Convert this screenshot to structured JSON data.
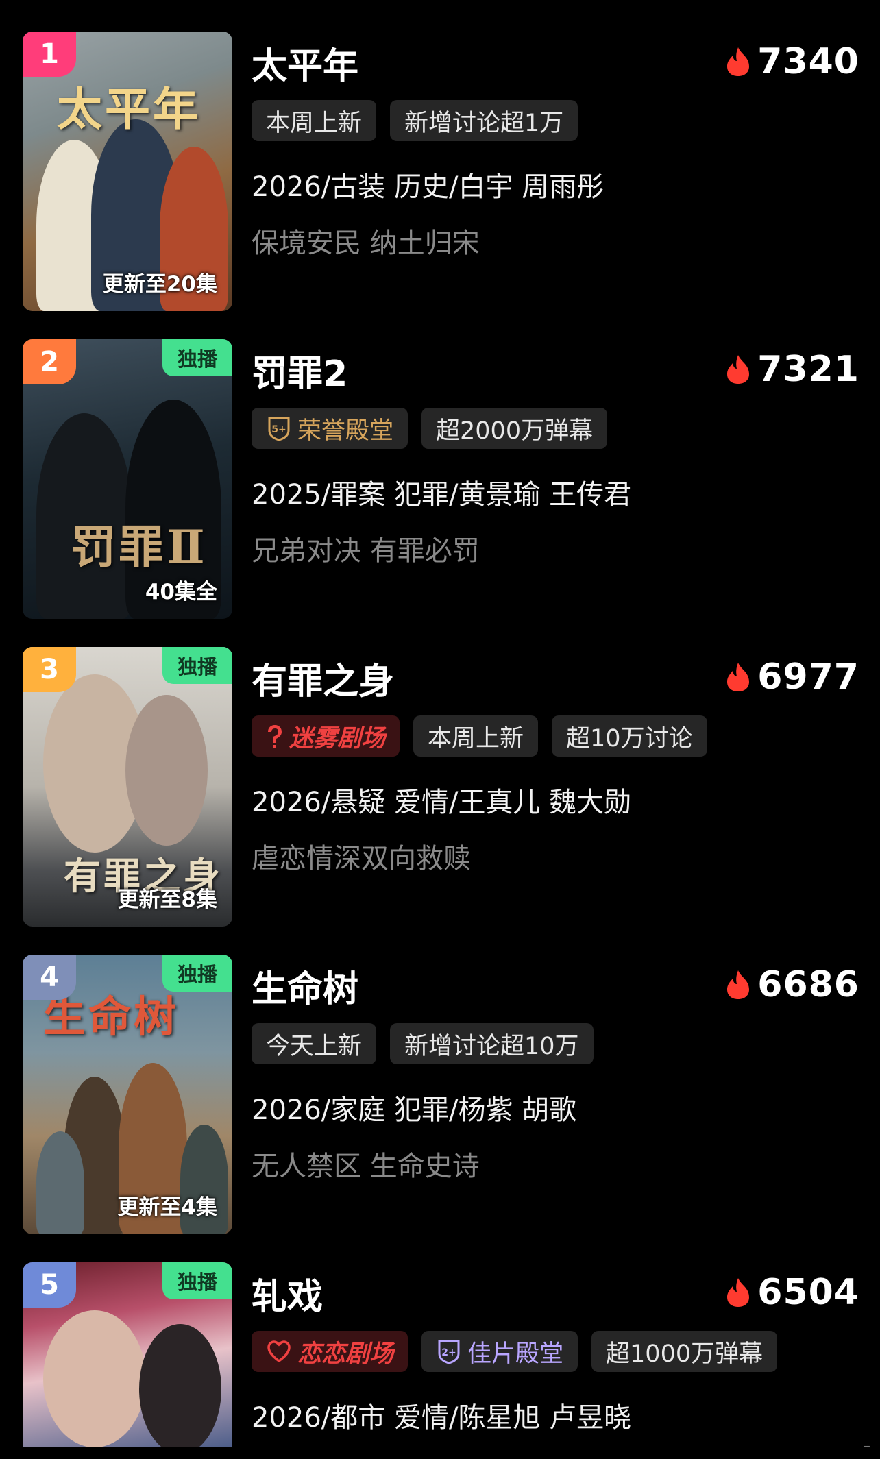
{
  "items": [
    {
      "rank": "1",
      "rank_color": "#ff3d7a",
      "exclusive": "",
      "poster_title": "太平年",
      "poster_bg": "linear-gradient(160deg,#9aa3a6 0%,#7e8a8c 30%,#8f6a43 60%,#5a3a24 100%)",
      "episodes": "更新至20集",
      "title": "太平年",
      "heat": "7340",
      "tags": [
        {
          "text": "本周上新",
          "style": "plain"
        },
        {
          "text": "新增讨论超1万",
          "style": "plain"
        }
      ],
      "meta": "2026/古装 历史/白宇 周雨彤",
      "desc": "保境安民 纳土归宋"
    },
    {
      "rank": "2",
      "rank_color": "#ff7a3d",
      "exclusive": "独播",
      "poster_title": "罚罪Ⅱ",
      "poster_bg": "linear-gradient(170deg,#3f4f5c 0%,#1d2a33 45%,#0d141a 100%)",
      "episodes": "40集全",
      "title": "罚罪2",
      "heat": "7321",
      "tags": [
        {
          "text": "荣誉殿堂",
          "style": "gold",
          "icon": "honor-hall-badge-icon",
          "badge": "5+"
        },
        {
          "text": "超2000万弹幕",
          "style": "plain"
        }
      ],
      "meta": "2025/罪案 犯罪/黄景瑜 王传君",
      "desc": "兄弟对决 有罪必罚"
    },
    {
      "rank": "3",
      "rank_color": "#ffb13d",
      "exclusive": "独播",
      "poster_title": "有罪之身",
      "poster_bg": "linear-gradient(180deg,#d9d6cf 0%,#b7b3ab 50%,#4d4f52 80%,#2a2c2e 100%)",
      "episodes": "更新至8集",
      "title": "有罪之身",
      "heat": "6977",
      "tags": [
        {
          "text": "迷雾剧场",
          "style": "red",
          "icon": "mist-theater-logo-icon"
        },
        {
          "text": "本周上新",
          "style": "plain"
        },
        {
          "text": "超10万讨论",
          "style": "plain"
        }
      ],
      "meta": "2026/悬疑 爱情/王真儿 魏大勋",
      "desc": "虐恋情深双向救赎"
    },
    {
      "rank": "4",
      "rank_color": "#7f8fb8",
      "exclusive": "独播",
      "poster_title": "生命树",
      "poster_bg": "linear-gradient(180deg,#5d7f95 0%,#7f95a0 35%,#a08768 65%,#5c4a38 100%)",
      "episodes": "更新至4集",
      "title": "生命树",
      "heat": "6686",
      "tags": [
        {
          "text": "今天上新",
          "style": "plain"
        },
        {
          "text": "新增讨论超10万",
          "style": "plain"
        }
      ],
      "meta": "2026/家庭 犯罪/杨紫 胡歌",
      "desc": "无人禁区 生命史诗"
    },
    {
      "rank": "5",
      "rank_color": "#6f8ad8",
      "exclusive": "独播",
      "poster_title": "",
      "poster_bg": "linear-gradient(170deg,#6b1f2b 0%,#b8506a 30%,#e8c2c9 55%,#4d5e8a 100%)",
      "episodes": "",
      "title": "轧戏",
      "heat": "6504",
      "tags": [
        {
          "text": "恋恋剧场",
          "style": "red",
          "icon": "romance-theater-logo-icon"
        },
        {
          "text": "佳片殿堂",
          "style": "violet",
          "icon": "fine-film-hall-badge-icon",
          "badge": "2+"
        },
        {
          "text": "超1000万弹幕",
          "style": "plain"
        }
      ],
      "meta": "2026/都市 爱情/陈星旭 卢昱晓",
      "desc": ""
    }
  ]
}
